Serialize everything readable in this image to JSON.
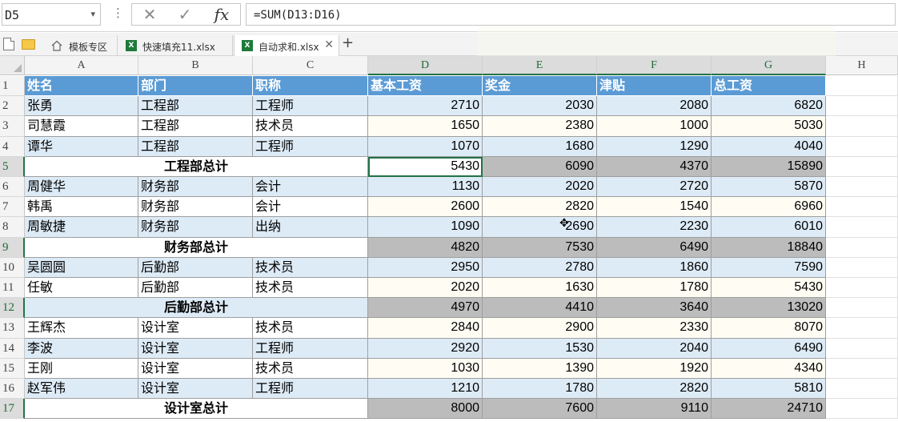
{
  "formula_bar": {
    "name_box": "D5",
    "name_box_arrow": "▾",
    "dots": "⋮",
    "cancel_icon": "✕",
    "enter_icon": "✓",
    "fx_label": "fx",
    "formula": "=SUM(D13:D16)"
  },
  "tabs": {
    "items": [
      {
        "label": "模板专区",
        "icon": "home-icon"
      },
      {
        "label": "快速填充11.xlsx",
        "icon": "excel-file-icon"
      },
      {
        "label": "自动求和.xlsx",
        "icon": "excel-file-icon",
        "active": true
      }
    ],
    "xl_badge": "X",
    "close_icon": "✕",
    "add_icon": "+"
  },
  "columns": [
    "A",
    "B",
    "C",
    "D",
    "E",
    "F",
    "G",
    "H"
  ],
  "row_numbers": [
    "1",
    "2",
    "3",
    "4",
    "5",
    "6",
    "7",
    "8",
    "9",
    "10",
    "11",
    "12",
    "13",
    "14",
    "15",
    "16",
    "17"
  ],
  "table": {
    "headers": [
      "姓名",
      "部门",
      "职称",
      "基本工资",
      "奖金",
      "津贴",
      "总工资"
    ],
    "rows": [
      {
        "type": "data",
        "name": "张勇",
        "dept": "工程部",
        "title": "工程师",
        "base": "2710",
        "bonus": "2030",
        "allowance": "2080",
        "total": "6820"
      },
      {
        "type": "data",
        "name": "司慧霞",
        "dept": "工程部",
        "title": "技术员",
        "base": "1650",
        "bonus": "2380",
        "allowance": "1000",
        "total": "5030"
      },
      {
        "type": "data",
        "name": "谭华",
        "dept": "工程部",
        "title": "工程师",
        "base": "1070",
        "bonus": "1680",
        "allowance": "1290",
        "total": "4040"
      },
      {
        "type": "subtotal",
        "label": "工程部总计",
        "base": "5430",
        "bonus": "6090",
        "allowance": "4370",
        "total": "15890"
      },
      {
        "type": "data",
        "name": "周健华",
        "dept": "财务部",
        "title": "会计",
        "base": "1130",
        "bonus": "2020",
        "allowance": "2720",
        "total": "5870"
      },
      {
        "type": "data",
        "name": "韩禹",
        "dept": "财务部",
        "title": "会计",
        "base": "2600",
        "bonus": "2820",
        "allowance": "1540",
        "total": "6960"
      },
      {
        "type": "data",
        "name": "周敏捷",
        "dept": "财务部",
        "title": "出纳",
        "base": "1090",
        "bonus": "2690",
        "allowance": "2230",
        "total": "6010"
      },
      {
        "type": "subtotal",
        "label": "财务部总计",
        "base": "4820",
        "bonus": "7530",
        "allowance": "6490",
        "total": "18840"
      },
      {
        "type": "data",
        "name": "吴圆圆",
        "dept": "后勤部",
        "title": "技术员",
        "base": "2950",
        "bonus": "2780",
        "allowance": "1860",
        "total": "7590"
      },
      {
        "type": "data",
        "name": "任敏",
        "dept": "后勤部",
        "title": "技术员",
        "base": "2020",
        "bonus": "1630",
        "allowance": "1780",
        "total": "5430"
      },
      {
        "type": "subtotal",
        "label": "后勤部总计",
        "base": "4970",
        "bonus": "4410",
        "allowance": "3640",
        "total": "13020"
      },
      {
        "type": "data",
        "name": "王辉杰",
        "dept": "设计室",
        "title": "技术员",
        "base": "2840",
        "bonus": "2900",
        "allowance": "2330",
        "total": "8070"
      },
      {
        "type": "data",
        "name": "李波",
        "dept": "设计室",
        "title": "工程师",
        "base": "2920",
        "bonus": "1530",
        "allowance": "2040",
        "total": "6490"
      },
      {
        "type": "data",
        "name": "王刚",
        "dept": "设计室",
        "title": "技术员",
        "base": "1030",
        "bonus": "1390",
        "allowance": "1920",
        "total": "4340"
      },
      {
        "type": "data",
        "name": "赵军伟",
        "dept": "设计室",
        "title": "工程师",
        "base": "1210",
        "bonus": "1780",
        "allowance": "2820",
        "total": "5810"
      },
      {
        "type": "subtotal",
        "label": "设计室总计",
        "base": "8000",
        "bonus": "7600",
        "allowance": "9110",
        "total": "24710"
      }
    ]
  },
  "colors": {
    "header_fill": "#5b9bd5",
    "band_fill": "#ddebf7",
    "subtotal_fill": "#bcbcbc",
    "selection_accent": "#217346"
  },
  "active_cell": "D5",
  "cursor_icon": "cell-cursor-icon"
}
